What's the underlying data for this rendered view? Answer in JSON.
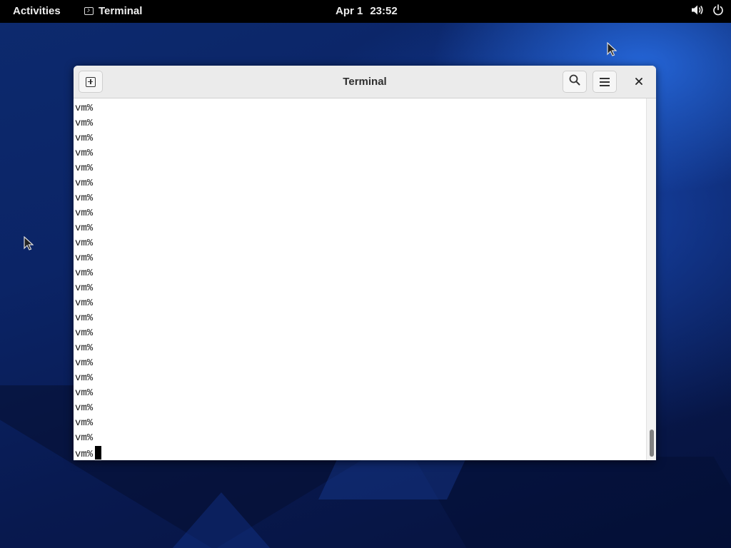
{
  "topbar": {
    "activities_label": "Activities",
    "app_name": "Terminal",
    "clock_date": "Apr 1",
    "clock_time": "23:52",
    "volume_icon": "volume-icon",
    "power_icon": "power-icon"
  },
  "window": {
    "title": "Terminal",
    "new_tab_icon": "new-tab-icon",
    "search_icon": "search-icon",
    "menu_icon": "hamburger-menu-icon",
    "close_label": "×"
  },
  "terminal": {
    "lines": [
      "vm%",
      "vm%",
      "vm%",
      "vm%",
      "vm%",
      "vm%",
      "vm%",
      "vm%",
      "vm%",
      "vm%",
      "vm%",
      "vm%",
      "vm%",
      "vm%",
      "vm%",
      "vm%",
      "vm%",
      "vm%",
      "vm%",
      "vm%",
      "vm%",
      "vm%",
      "vm%"
    ],
    "prompt": "vm% "
  },
  "colors": {
    "topbar_bg": "#000000",
    "terminal_bg": "#ffffff",
    "terminal_fg": "#1a1a1a",
    "headerbar_bg": "#ebebeb"
  }
}
